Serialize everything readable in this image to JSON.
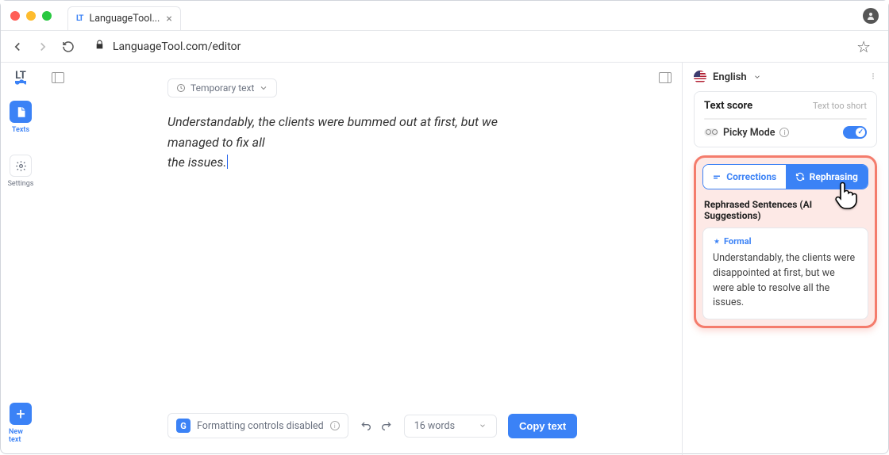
{
  "browser": {
    "tab_title": "LanguageTool...",
    "url": "LanguageTool.com/editor"
  },
  "left_rail": {
    "texts_label": "Texts",
    "settings_label": "Settings",
    "new_text_label": "New text"
  },
  "editor": {
    "doc_chip": "Temporary text",
    "body": "Understandably, the clients were bummed out at first, but we managed to fix all the issues.",
    "body_line1": "Understandably, the clients were bummed out at first, but we managed to fix all",
    "body_line2": "the issues."
  },
  "bottom": {
    "format_text": "Formatting controls disabled",
    "words": "16 words",
    "copy": "Copy text"
  },
  "right": {
    "language": "English",
    "score_title": "Text score",
    "score_note": "Text too short",
    "picky": "Picky Mode",
    "tabs": {
      "corrections": "Corrections",
      "rephrasing": "Rephrasing"
    },
    "section_title": "Rephrased Sentences (AI Suggestions)",
    "suggestion": {
      "tag": "Formal",
      "text": "Understandably, the clients were disappointed at first, but we were able to resolve all the issues."
    }
  }
}
